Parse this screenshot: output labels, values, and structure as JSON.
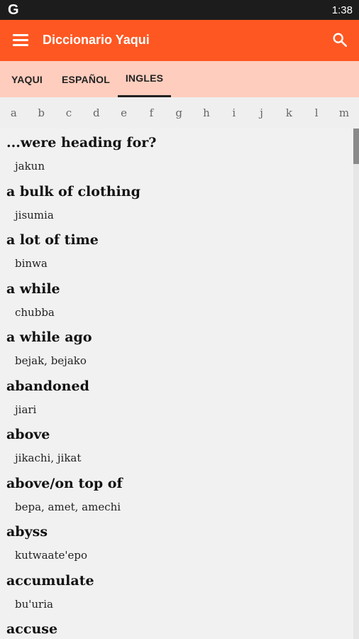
{
  "status_bar": {
    "left_icon_text": "G",
    "time": "1:38"
  },
  "app_bar": {
    "title": "Diccionario Yaqui",
    "menu_icon": "hamburger-menu-icon",
    "search_icon": "search-icon"
  },
  "tabs": [
    {
      "label": "YAQUI",
      "active": false
    },
    {
      "label": "ESPAÑOL",
      "active": false
    },
    {
      "label": "INGLES",
      "active": true
    }
  ],
  "letters": [
    "a",
    "b",
    "c",
    "d",
    "e",
    "f",
    "g",
    "h",
    "i",
    "j",
    "k",
    "l",
    "m"
  ],
  "entries": [
    {
      "term": "...were heading for?",
      "translation": "jakun"
    },
    {
      "term": "a bulk of clothing",
      "translation": "jisumia"
    },
    {
      "term": "a lot of time",
      "translation": "binwa"
    },
    {
      "term": "a while",
      "translation": "chubba"
    },
    {
      "term": "a while ago",
      "translation": "bejak, bejako"
    },
    {
      "term": "abandoned",
      "translation": "jiari"
    },
    {
      "term": "above",
      "translation": "jikachi, jikat"
    },
    {
      "term": "above/on top of",
      "translation": "bepa, amet, amechi"
    },
    {
      "term": "abyss",
      "translation": "kutwaate'epo"
    },
    {
      "term": "accumulate",
      "translation": "bu'uria"
    },
    {
      "term": "accuse",
      "translation": ""
    }
  ],
  "colors": {
    "app_bar": "#ff5722",
    "tab_bar": "#ffcdbd",
    "status_bar": "#1c1c1c"
  }
}
